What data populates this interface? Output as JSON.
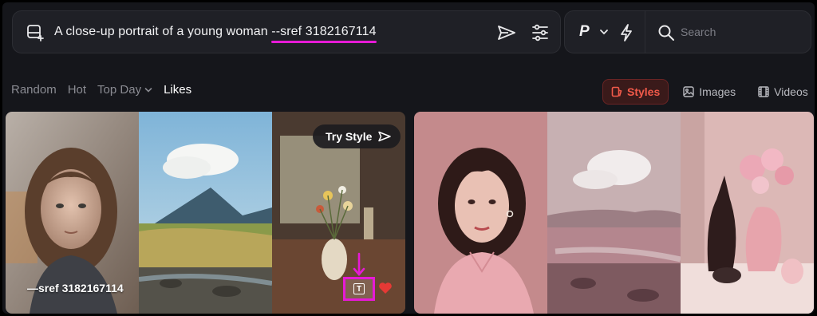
{
  "prompt": {
    "text_main": "A close-up portrait of a young woman ",
    "text_sref": "--sref 3182167114"
  },
  "mode": {
    "label": "P"
  },
  "search": {
    "placeholder": "Search"
  },
  "filters": [
    {
      "label": "Random",
      "active": false
    },
    {
      "label": "Hot",
      "active": false
    },
    {
      "label": "Top Day",
      "active": false
    },
    {
      "label": "Likes",
      "active": true
    }
  ],
  "view_tabs": [
    {
      "label": "Styles",
      "icon": "styles-icon",
      "active": true
    },
    {
      "label": "Images",
      "icon": "image-icon",
      "active": false
    },
    {
      "label": "Videos",
      "icon": "film-icon",
      "active": false
    }
  ],
  "cards": [
    {
      "sref_label": "—sref 3182167114",
      "try_style_label": "Try Style"
    }
  ],
  "colors": {
    "accent_red": "#f25a4a",
    "highlight_magenta": "#e61ad6",
    "heart": "#e53935"
  }
}
